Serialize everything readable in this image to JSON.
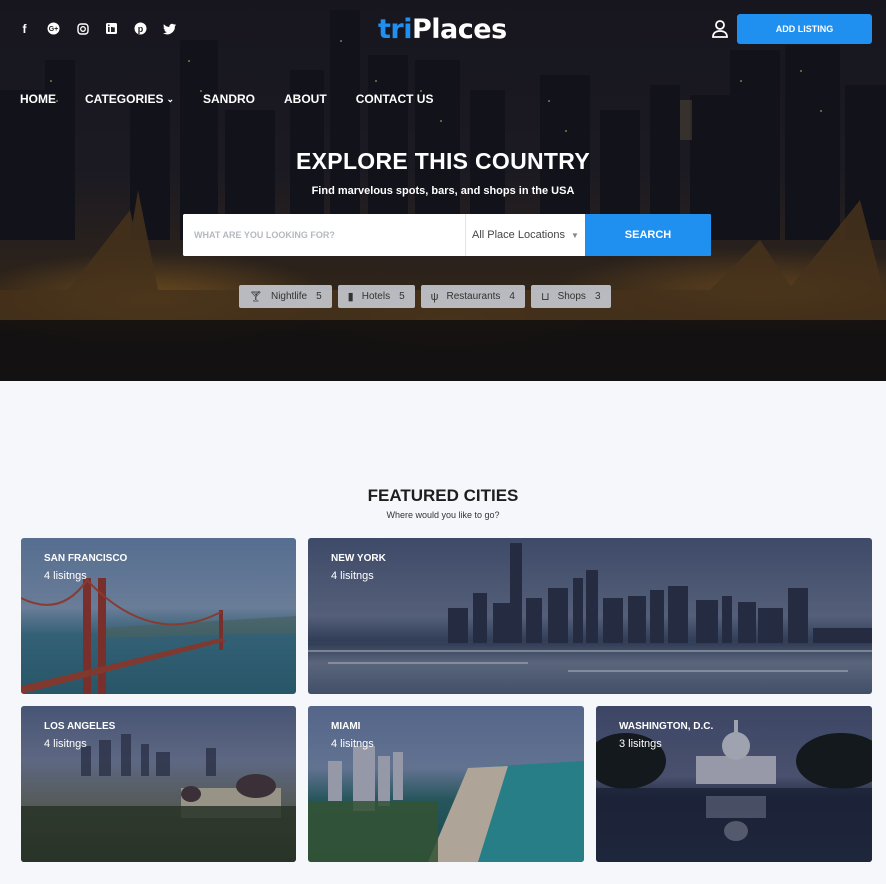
{
  "header": {
    "logo_prefix": "tri",
    "logo_rest": "Places",
    "add_listing": "ADD LISTING",
    "social_icons": [
      "facebook-icon",
      "google-plus-icon",
      "instagram-icon",
      "linkedin-icon",
      "pinterest-icon",
      "twitter-icon"
    ]
  },
  "nav": {
    "items": [
      "HOME",
      "CATEGORIES",
      "SANDRO",
      "ABOUT",
      "CONTACT US"
    ]
  },
  "hero": {
    "title": "EXPLORE THIS COUNTRY",
    "subtitle": "Find marvelous spots, bars, and shops in the USA"
  },
  "search": {
    "placeholder": "WHAT ARE YOU LOOKING FOR?",
    "location": "All Place Locations",
    "button": "SEARCH"
  },
  "categories": [
    {
      "label": "Nightlife",
      "count": "5",
      "icon": "cocktail-icon"
    },
    {
      "label": "Hotels",
      "count": "5",
      "icon": "hotel-icon"
    },
    {
      "label": "Restaurants",
      "count": "4",
      "icon": "utensils-icon"
    },
    {
      "label": "Shops",
      "count": "3",
      "icon": "basket-icon"
    }
  ],
  "featured": {
    "title": "FEATURED CITIES",
    "subtitle": "Where would you like to go?",
    "cities": [
      {
        "name": "SAN FRANCISCO",
        "count": "4 lisitngs"
      },
      {
        "name": "NEW YORK",
        "count": "4 lisitngs"
      },
      {
        "name": "LOS ANGELES",
        "count": "4 lisitngs"
      },
      {
        "name": "MIAMI",
        "count": "4 lisitngs"
      },
      {
        "name": "WASHINGTON, D.C.",
        "count": "3 lisitngs"
      }
    ]
  },
  "colors": {
    "accent": "#1f8ff0",
    "background": "#f5f7fa"
  }
}
